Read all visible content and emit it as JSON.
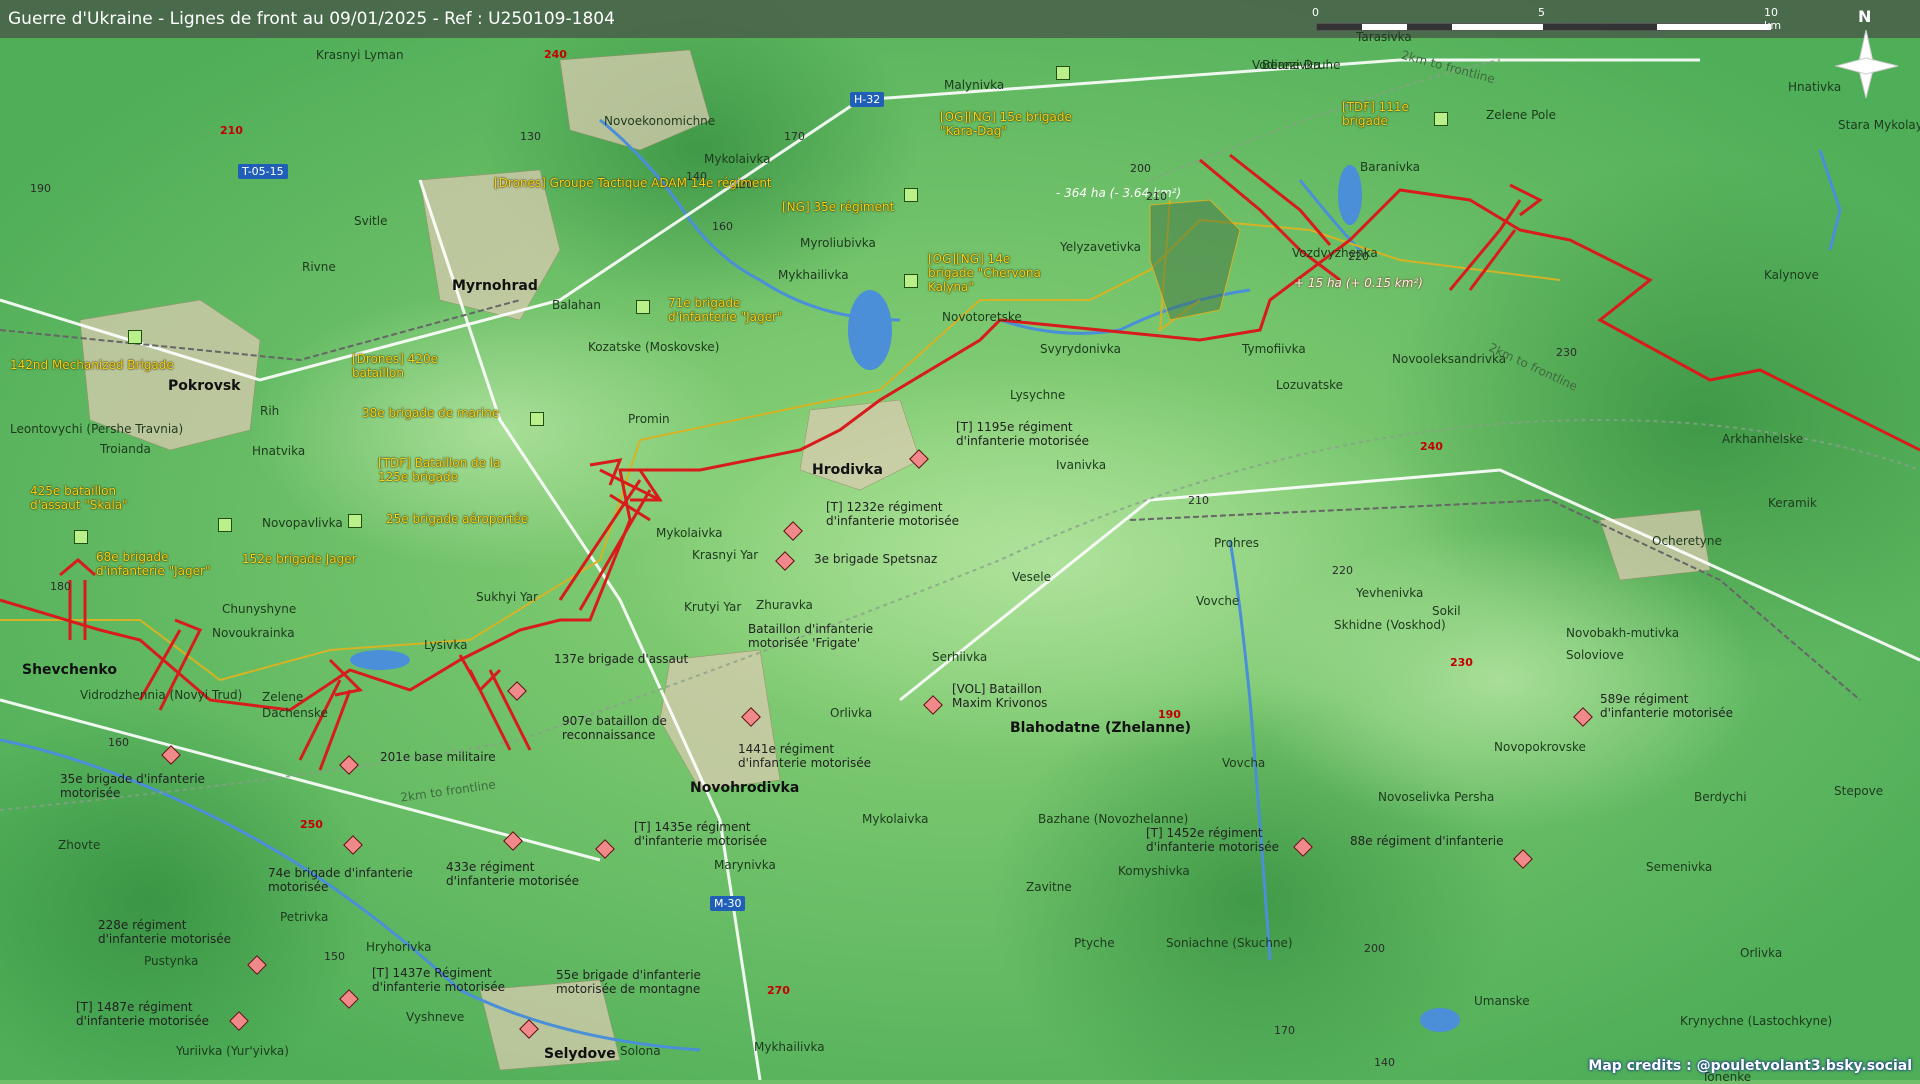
{
  "header": {
    "title": "Guerre d'Ukraine - Lignes de front au 09/01/2025 - Ref : U250109-1804",
    "scale": {
      "ticks": [
        "0",
        "5",
        "10 km"
      ]
    },
    "north": "N"
  },
  "credits": "Map credits : @pouletvolant3.bsky.social",
  "annotations": {
    "loss": "- 364 ha (- 3.64 km²)",
    "gain": "+ 15 ha (+ 0.15 km²)",
    "frontline_2km": "2km to frontline"
  },
  "roads": [
    "T-05-15",
    "H-32",
    "M-30"
  ],
  "places": [
    "Krasnyi Lyman",
    "Novoekonomichne",
    "Malynivka",
    "Berezivka",
    "Tarasivka",
    "Vodiane Druhe",
    "Hnativka",
    "Stara Mykolayivka",
    "Zelene Pole",
    "Baranivka",
    "Mykolaivka",
    "Svitle",
    "Rivne",
    "Myroliubivka",
    "Mykhailivka",
    "Yelyzavetivka",
    "Vozdvyzhenka",
    "Kalynove",
    "Novotoretske",
    "Svyrydonivka",
    "Tymofiivka",
    "Lozuvatske",
    "Novooleksandrivka",
    "Balahan",
    "Kozatske (Moskovske)",
    "Promin",
    "Lysychne",
    "Arkhanhelske",
    "Leontovychi (Pershe Travnia)",
    "Troianda",
    "Hnatvika",
    "Rih",
    "Ivanivka",
    "Keramik",
    "Novopavlivka",
    "Mykolaivka",
    "Krasnyi Yar",
    "Zhuravka",
    "Sukhyi Yar",
    "Krutyi Yar",
    "Prohres",
    "Ocheretyne",
    "Chunyshyne",
    "Novoukrainka",
    "Lysivka",
    "Vesele",
    "Yevhenivka",
    "Sokil",
    "Skhidne (Voskhod)",
    "Novobakh-mutivka",
    "Soloviove",
    "Vovche",
    "Vidrodzhennia (Novyi Trud)",
    "Zelene",
    "Dachenske",
    "Orlivka",
    "Serhiivka",
    "Novopokrovske",
    "Berdychi",
    "Stepove",
    "Novoselivka Persha",
    "Zhovte",
    "Mykolaivka",
    "Bazhane (Novozhelanne)",
    "Komyshivka",
    "Semenivka",
    "Petrivka",
    "Marynivka",
    "Zavitne",
    "Pustynka",
    "Hryhorivka",
    "Ptyche",
    "Soniachne (Skuchne)",
    "Orlivka",
    "Vyshneve",
    "Umanske",
    "Krynychne (Lastochkyne)",
    "Yuriivka (Yur'yivka)",
    "Mykhailivka",
    "Tonenke",
    "Vovcha",
    "Solona"
  ],
  "towns": [
    "Myrnohrad",
    "Pokrovsk",
    "Hrodivka",
    "Shevchenko",
    "Novohrodivka",
    "Blahodatne (Zhelanne)",
    "Selydove"
  ],
  "ua_units": [
    "[Drones] Groupe Tactique ADAM 14e régiment",
    "[OG][NG] 15e brigade \"Kara-Dag\"",
    "[TDF] 111e brigade",
    "[NG] 35e régiment",
    "[OG][NG] 14e brigade \"Chervona Kalyna\"",
    "71e brigade d'infanterie \"Jager\"",
    "142nd Mechanized Brigade",
    "[Drones] 420e bataillon",
    "38e brigade de marine",
    "[TDF] Bataillon de la 125e brigade",
    "425e bataillon d'assaut \"Skala\"",
    "25e brigade aéroportée",
    "68e brigade d'infanterie \"Jager\"",
    "152e brigade Jager"
  ],
  "ru_units": [
    "[T] 1195e régiment d'infanterie motorisée",
    "[T] 1232e régiment d'infanterie motorisée",
    "3e brigade Spetsnaz",
    "Bataillon d'infanterie motorisée 'Frigate'",
    "137e brigade d'assaut",
    "907e bataillon de reconnaissance",
    "[VOL] Bataillon Maxim Krivonos",
    "1441e régiment d'infanterie motorisée",
    "201e base militaire",
    "35e brigade d'infanterie motorisée",
    "589e régiment d'infanterie motorisée",
    "[T] 1435e régiment d'infanterie motorisée",
    "74e brigade d'infanterie motorisée",
    "433e régiment d'infanterie motorisée",
    "[T] 1452e régiment d'infanterie motorisée",
    "88e régiment d'infanterie",
    "228e régiment d'infanterie motorisée",
    "[T] 1437e Régiment d'infanterie motorisée",
    "55e brigade d'infanterie motorisée de montagne",
    "[T] 1487e régiment d'infanterie motorisée"
  ],
  "elevations": [
    "240",
    "210",
    "190",
    "130",
    "120",
    "170",
    "140",
    "160",
    "200",
    "210",
    "220",
    "230",
    "240",
    "210",
    "180",
    "160",
    "150",
    "270",
    "250",
    "220",
    "230",
    "190",
    "200",
    "170",
    "140"
  ],
  "colors": {
    "frontline": "#d81b1b",
    "ua_line": "#d6b324",
    "road_major": "#ffffff",
    "water": "#4a8fd8"
  }
}
